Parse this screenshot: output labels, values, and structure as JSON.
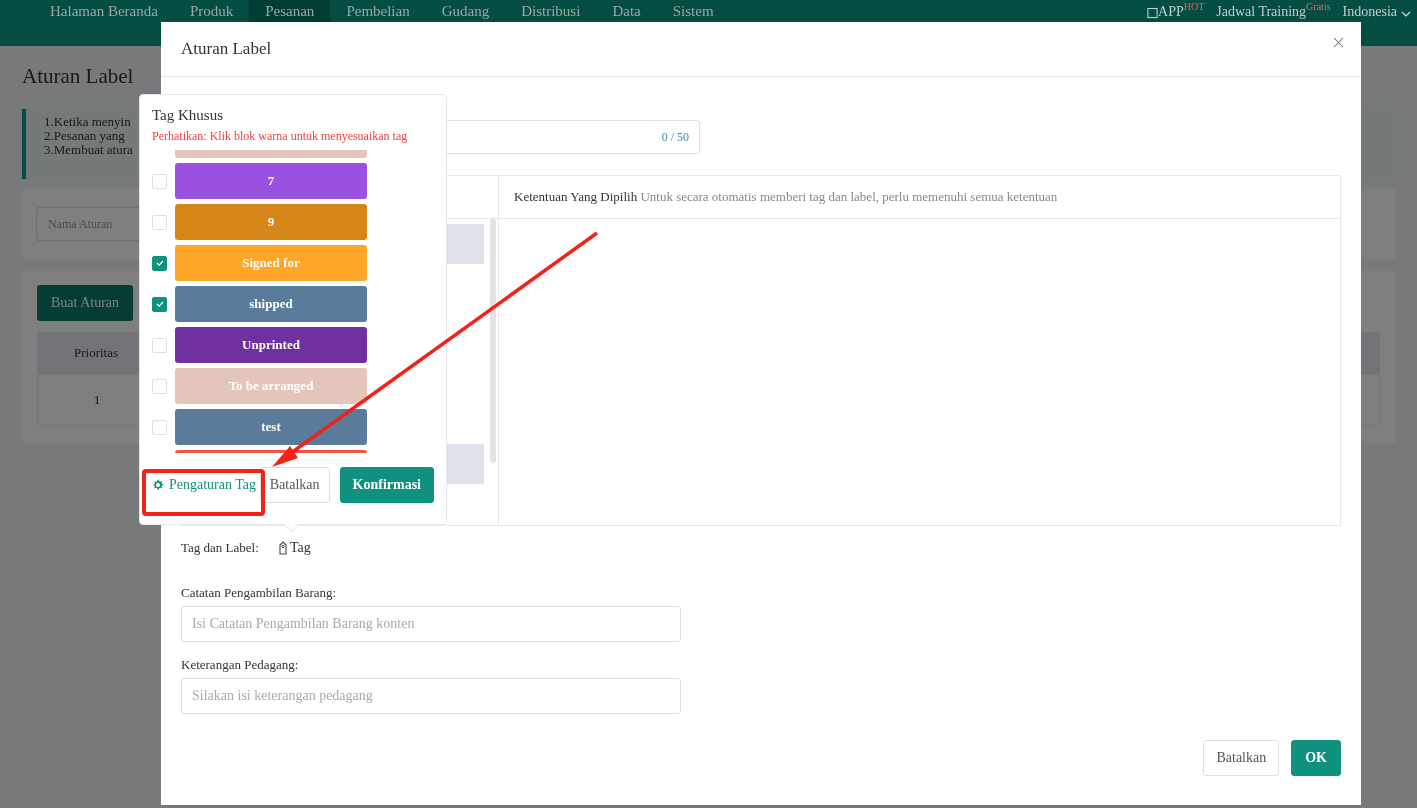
{
  "nav": {
    "items": [
      {
        "label": "Halaman Beranda",
        "selected": false
      },
      {
        "label": "Produk",
        "selected": false
      },
      {
        "label": "Pesanan",
        "selected": true
      },
      {
        "label": "Pembelian",
        "selected": false
      },
      {
        "label": "Gudang",
        "selected": false
      },
      {
        "label": "Distribusi",
        "selected": false
      },
      {
        "label": "Data",
        "selected": false
      },
      {
        "label": "Sistem",
        "selected": false
      }
    ],
    "app": {
      "label": "APP",
      "badge": "HOT"
    },
    "training": {
      "label": "Jadwal Training",
      "badge": "Gratis"
    },
    "language": "Indonesia"
  },
  "page": {
    "title": "Aturan Label",
    "notices": [
      "1.Ketika menyin",
      "2.Pesanan yang",
      "3.Membuat atura"
    ],
    "filter": {
      "placeholder": "Nama Aturan"
    },
    "create_button": "Buat Aturan",
    "table": {
      "columns": [
        "Prioritas"
      ],
      "rows": [
        [
          "1"
        ]
      ]
    }
  },
  "modal": {
    "title": "Aturan Label",
    "name_field": {
      "counter": "0 / 50"
    },
    "conditions": {
      "selected_title": "Ketentuan Yang Dipilih",
      "selected_hint": "Untuk secara otomatis memberi tag dan label, perlu memenuhi semua ketentuan"
    },
    "tag_label": {
      "label": "Tag dan Label:",
      "value": "Tag"
    },
    "picking_note": {
      "label": "Catatan Pengambilan Barang:",
      "placeholder": "Isi Catatan Pengambilan Barang konten"
    },
    "merchant_note": {
      "label": "Keterangan Pedagang:",
      "placeholder": "Silakan isi keterangan pedagang"
    },
    "buttons": [
      {
        "label": "Batalkan",
        "kind": "secondary"
      },
      {
        "label": "OK",
        "kind": "primary"
      }
    ]
  },
  "popover": {
    "title": "Tag Khusus",
    "note": "Perhatikan: Klik blok warna untuk menyesuaikan tag",
    "tags": [
      {
        "color": "#e3c5bb"
      },
      {
        "label": "7",
        "color": "#9b51e0",
        "checked": false
      },
      {
        "label": "9",
        "color": "#d68618",
        "checked": false
      },
      {
        "label": "Signed for",
        "color": "#ffa629",
        "checked": true
      },
      {
        "label": "shipped",
        "color": "#5b7b9a",
        "checked": true
      },
      {
        "label": "Unprinted",
        "color": "#7030a0",
        "checked": false
      },
      {
        "label": "To be arranged",
        "color": "#e3c5bb",
        "checked": false
      },
      {
        "label": "test",
        "color": "#5b7b9a",
        "checked": false
      },
      {
        "color": "#f0524a"
      }
    ],
    "settings_link": "Pengaturan Tag",
    "cancel": "Batalkan",
    "confirm": "Konfirmasi"
  }
}
